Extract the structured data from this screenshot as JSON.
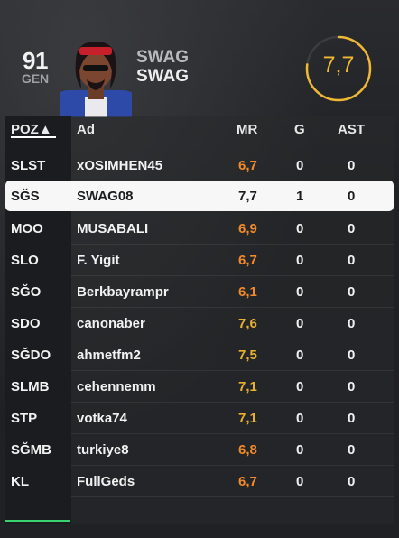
{
  "header": {
    "rating": "91",
    "rating_position": "GEN",
    "name_line1": "SWAG",
    "name_line2": "SWAG",
    "match_rating": "7,7",
    "match_rating_fraction": 0.77
  },
  "table": {
    "columns": {
      "position": "POZ▲",
      "name": "Ad",
      "mr": "MR",
      "goals": "G",
      "assists": "AST"
    },
    "rows": [
      {
        "pos": "SLST",
        "name": "xOSIMHEN45",
        "mr": "6,7",
        "g": "0",
        "ast": "0",
        "mr_color": "orange"
      },
      {
        "pos": "SĞS",
        "name": "SWAG08",
        "mr": "7,7",
        "g": "1",
        "ast": "0",
        "mr_color": "white",
        "selected": true
      },
      {
        "pos": "MOO",
        "name": "MUSABALI",
        "mr": "6,9",
        "g": "0",
        "ast": "0",
        "mr_color": "orange"
      },
      {
        "pos": "SLO",
        "name": "F. Yigit",
        "mr": "6,7",
        "g": "0",
        "ast": "0",
        "mr_color": "orange"
      },
      {
        "pos": "SĞO",
        "name": "Berkbayrampr",
        "mr": "6,1",
        "g": "0",
        "ast": "0",
        "mr_color": "orange"
      },
      {
        "pos": "SDO",
        "name": "canonaber",
        "mr": "7,6",
        "g": "0",
        "ast": "0",
        "mr_color": "gold"
      },
      {
        "pos": "SĞDO",
        "name": "ahmetfm2",
        "mr": "7,5",
        "g": "0",
        "ast": "0",
        "mr_color": "gold"
      },
      {
        "pos": "SLMB",
        "name": "cehennemm",
        "mr": "7,1",
        "g": "0",
        "ast": "0",
        "mr_color": "gold"
      },
      {
        "pos": "STP",
        "name": "votka74",
        "mr": "7,1",
        "g": "0",
        "ast": "0",
        "mr_color": "gold"
      },
      {
        "pos": "SĞMB",
        "name": "turkiye8",
        "mr": "6,8",
        "g": "0",
        "ast": "0",
        "mr_color": "orange"
      },
      {
        "pos": "KL",
        "name": "FullGeds",
        "mr": "6,7",
        "g": "0",
        "ast": "0",
        "mr_color": "orange"
      }
    ]
  },
  "colors": {
    "accent_gold": "#f0b833",
    "mr_orange": "#f08a2c",
    "mr_gold": "#e8b22e",
    "sort_underline": "#ffffff",
    "bottom_indicator": "#38d36e"
  }
}
